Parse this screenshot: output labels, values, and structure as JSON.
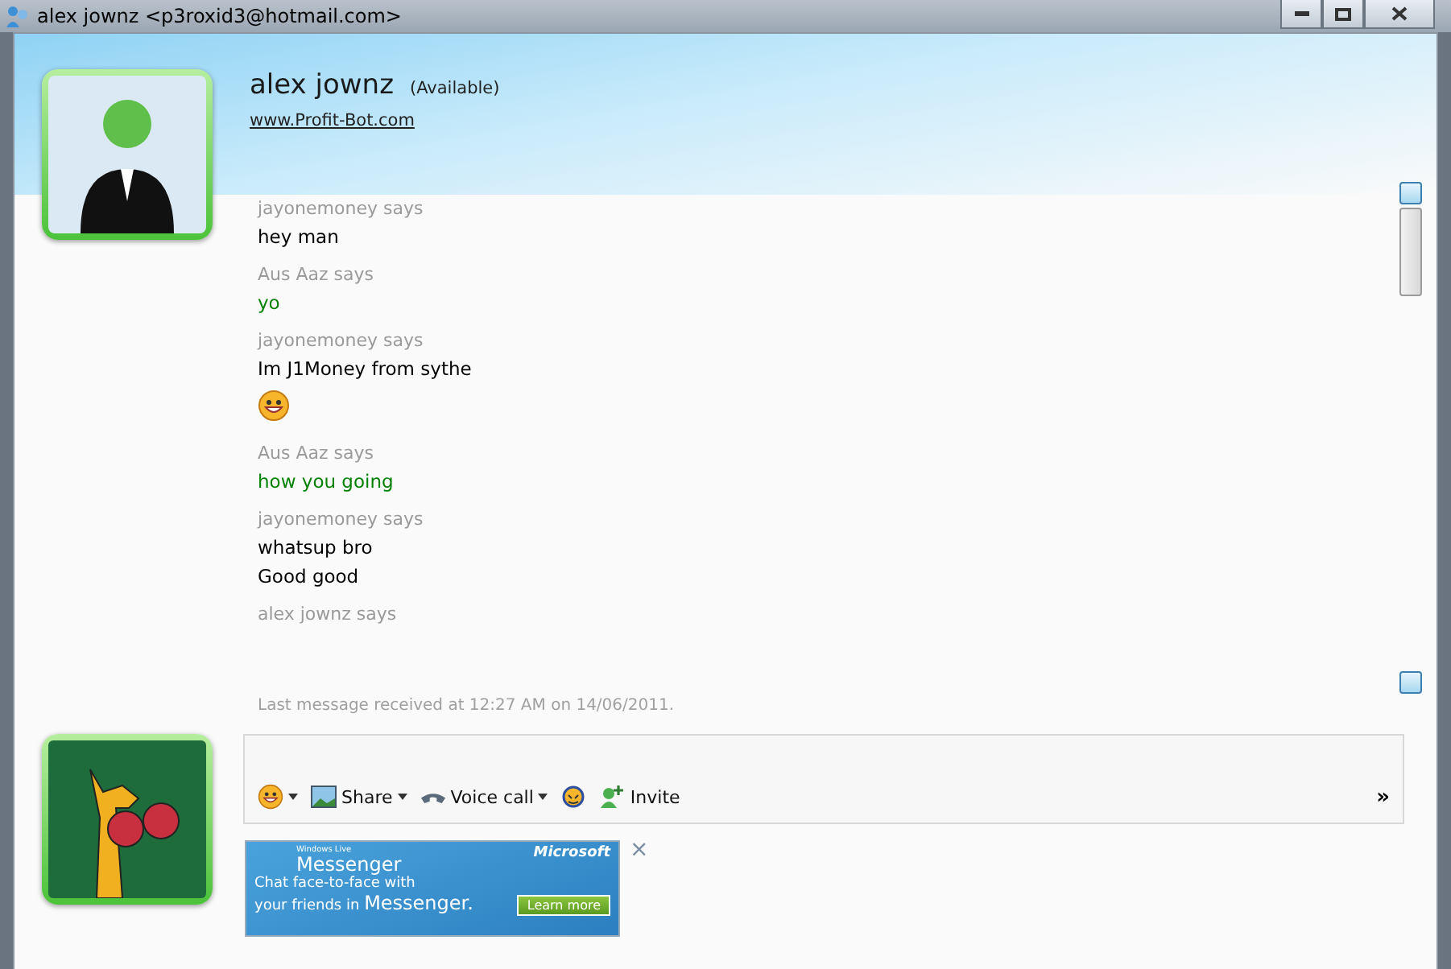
{
  "window": {
    "title": "alex jownz <p3roxid3@hotmail.com>"
  },
  "contact": {
    "name": "alex jownz",
    "status": "(Available)",
    "link": "www.Profit-Bot.com"
  },
  "messages": [
    {
      "sender": "jayonemoney says",
      "lines": [
        {
          "kind": "text",
          "text": "hey man"
        }
      ],
      "own": false
    },
    {
      "sender": "Aus Aaz says",
      "lines": [
        {
          "kind": "text",
          "text": "yo"
        }
      ],
      "own": true
    },
    {
      "sender": "jayonemoney says",
      "lines": [
        {
          "kind": "text",
          "text": "Im J1Money from sythe"
        },
        {
          "kind": "emoticon"
        }
      ],
      "own": false
    },
    {
      "sender": "Aus Aaz says",
      "lines": [
        {
          "kind": "text",
          "text": "how  you  going"
        }
      ],
      "own": true
    },
    {
      "sender": "jayonemoney says",
      "lines": [
        {
          "kind": "text",
          "text": "whatsup bro"
        },
        {
          "kind": "text",
          "text": "Good good"
        }
      ],
      "own": false
    },
    {
      "sender": "alex jownz says"
    }
  ],
  "last_received": "Last message received at 12:27 AM on 14/06/2011.",
  "toolbar": [
    {
      "kind": "emoticon",
      "dropdown": true
    },
    {
      "kind": "share",
      "label": "Share",
      "dropdown": true
    },
    {
      "kind": "voice",
      "label": "Voice call",
      "dropdown": true
    },
    {
      "kind": "wink",
      "dropdown": false
    },
    {
      "kind": "invite",
      "label": "Invite",
      "dropdown": false
    }
  ],
  "more": "»",
  "ad": {
    "brand_small": "Windows Live",
    "product": "Messenger",
    "company": "Microsoft",
    "line1": "Chat face-to-face with",
    "line2a": "your friends in",
    "line2b": "Messenger.",
    "button": "Learn more",
    "close": "×"
  }
}
